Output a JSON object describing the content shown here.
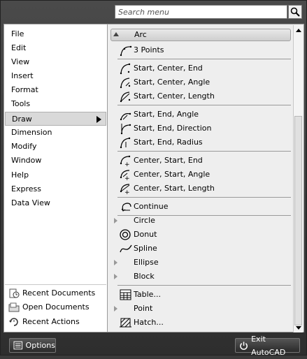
{
  "search": {
    "placeholder": "Search menu"
  },
  "menu": {
    "items": [
      {
        "label": "File"
      },
      {
        "label": "Edit"
      },
      {
        "label": "View"
      },
      {
        "label": "Insert"
      },
      {
        "label": "Format"
      },
      {
        "label": "Tools"
      },
      {
        "label": "Draw",
        "selected": true
      },
      {
        "label": "Dimension"
      },
      {
        "label": "Modify"
      },
      {
        "label": "Window"
      },
      {
        "label": "Help"
      },
      {
        "label": "Express"
      },
      {
        "label": "Data View"
      }
    ]
  },
  "recent": {
    "items": [
      {
        "label": "Recent Documents",
        "icon": "recent-documents-icon"
      },
      {
        "label": "Open Documents",
        "icon": "open-documents-icon"
      },
      {
        "label": "Recent Actions",
        "icon": "recent-actions-icon"
      }
    ]
  },
  "submenu": {
    "header": "Arc",
    "groups": [
      [
        {
          "label": "3 Points",
          "icon": "arc-3points-icon"
        }
      ],
      [
        {
          "label": "Start, Center, End",
          "icon": "arc-sce-icon"
        },
        {
          "label": "Start, Center, Angle",
          "icon": "arc-sca-icon"
        },
        {
          "label": "Start, Center, Length",
          "icon": "arc-scl-icon"
        }
      ],
      [
        {
          "label": "Start, End, Angle",
          "icon": "arc-sea-icon"
        },
        {
          "label": "Start, End, Direction",
          "icon": "arc-sed-icon"
        },
        {
          "label": "Start, End, Radius",
          "icon": "arc-ser-icon"
        }
      ],
      [
        {
          "label": "Center, Start, End",
          "icon": "arc-cse-icon"
        },
        {
          "label": "Center, Start, Angle",
          "icon": "arc-csa-icon"
        },
        {
          "label": "Center, Start, Length",
          "icon": "arc-csl-icon"
        }
      ],
      [
        {
          "label": "Continue",
          "icon": "arc-continue-icon"
        }
      ]
    ],
    "items": [
      {
        "label": "Circle",
        "submenu": true
      },
      {
        "label": "Donut",
        "icon": "donut-icon"
      },
      {
        "label": "Spline",
        "icon": "spline-icon"
      },
      {
        "label": "Ellipse",
        "submenu": true
      },
      {
        "label": "Block",
        "submenu": true
      }
    ],
    "items2": [
      {
        "label": "Table...",
        "icon": "table-icon"
      },
      {
        "label": "Point",
        "submenu": true
      },
      {
        "label": "Hatch...",
        "icon": "hatch-icon"
      }
    ]
  },
  "footer": {
    "options_label": "Options",
    "exit_label": "Exit AutoCAD"
  }
}
